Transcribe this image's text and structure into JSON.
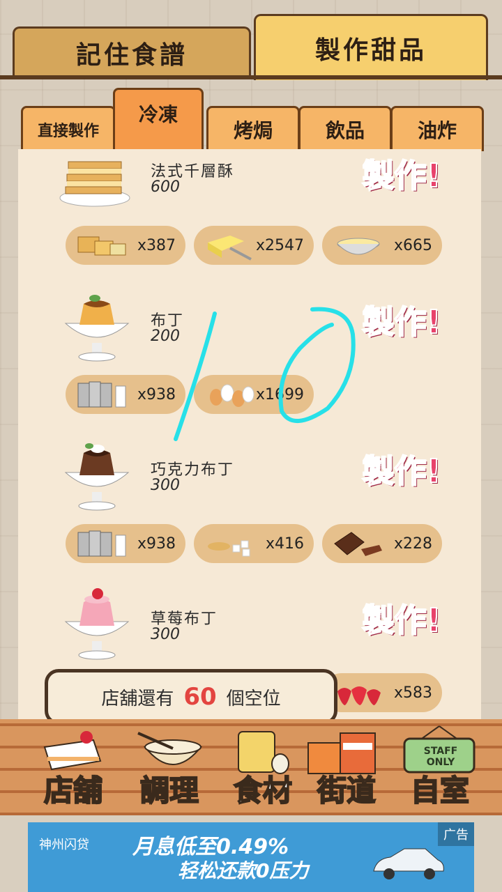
{
  "top_tabs": [
    {
      "label": "記住食譜"
    },
    {
      "label": "製作甜品"
    }
  ],
  "sub_tabs": [
    {
      "label": "直接製作"
    },
    {
      "label": "冷凍"
    },
    {
      "label": "烤焗"
    },
    {
      "label": "飲品"
    },
    {
      "label": "油炸"
    }
  ],
  "make_label": "製作!",
  "recipes": [
    {
      "name": "法式千層酥",
      "price": "600",
      "ingredients": [
        {
          "icon": "pastry-sheet-icon",
          "qty": "x387"
        },
        {
          "icon": "butter-icon",
          "qty": "x2547"
        },
        {
          "icon": "cream-bowl-icon",
          "qty": "x665"
        }
      ]
    },
    {
      "name": "布丁",
      "price": "200",
      "ingredients": [
        {
          "icon": "milk-icon",
          "qty": "x938"
        },
        {
          "icon": "egg-icon",
          "qty": "x1699"
        }
      ]
    },
    {
      "name": "巧克力布丁",
      "price": "300",
      "ingredients": [
        {
          "icon": "milk-icon",
          "qty": "x938"
        },
        {
          "icon": "sugar-icon",
          "qty": "x416"
        },
        {
          "icon": "chocolate-icon",
          "qty": "x228"
        }
      ]
    },
    {
      "name": "草莓布丁",
      "price": "300",
      "ingredients": [
        {
          "icon": "strawberry-icon",
          "qty": "x583"
        }
      ]
    }
  ],
  "status": {
    "prefix": "店舖還有",
    "count": "60",
    "suffix": "個空位"
  },
  "nav": [
    {
      "label": "店舖"
    },
    {
      "label": "調理"
    },
    {
      "label": "食材"
    },
    {
      "label": "街道"
    },
    {
      "label": "自室"
    }
  ],
  "nav_sign": "STAFF ONLY",
  "ad": {
    "brand": "神州闪贷",
    "line1": "月息低至0.49%",
    "line2": "轻松还款0压力",
    "tag": "广告"
  }
}
